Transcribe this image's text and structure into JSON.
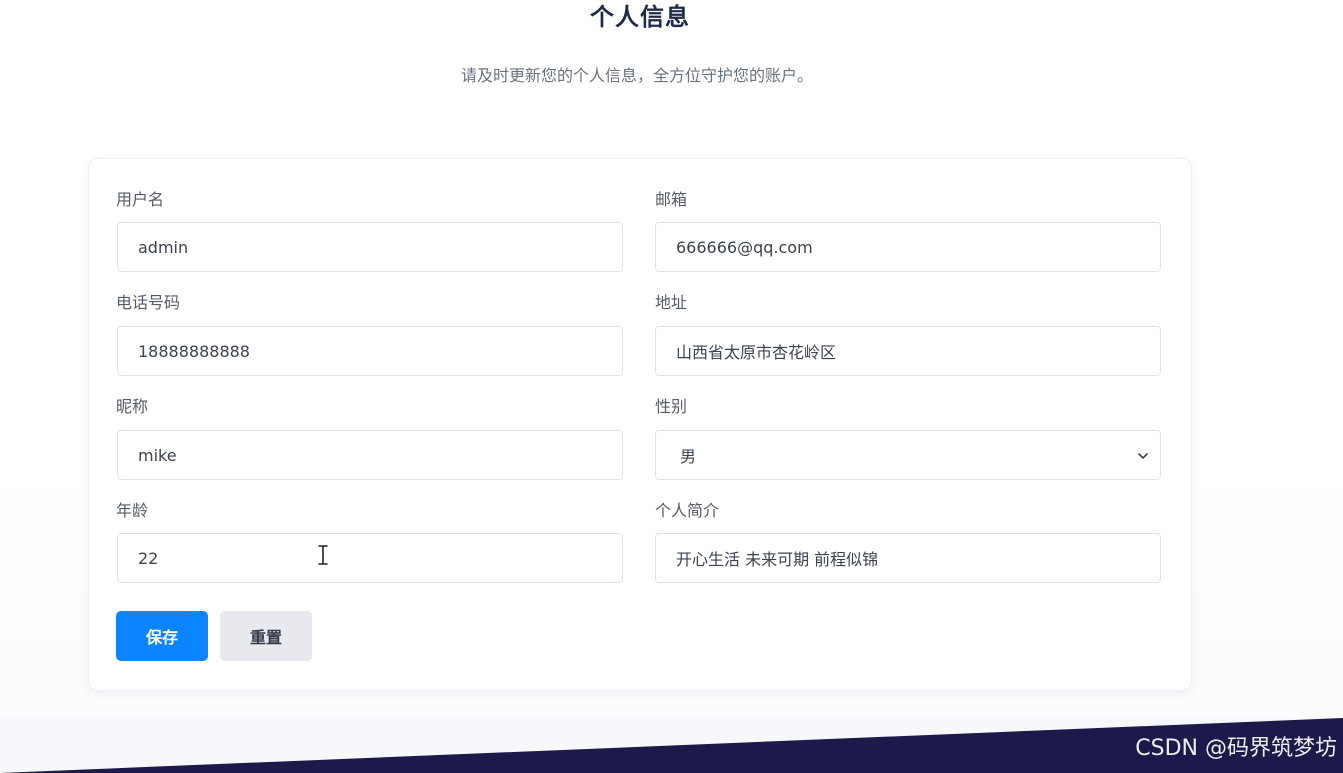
{
  "header": {
    "title": "个人信息",
    "subtitle": "请及时更新您的个人信息，全方位守护您的账户。"
  },
  "form": {
    "username": {
      "label": "用户名",
      "value": "admin"
    },
    "email": {
      "label": "邮箱",
      "value": "666666@qq.com"
    },
    "phone": {
      "label": "电话号码",
      "value": "18888888888"
    },
    "address": {
      "label": "地址",
      "value": "山西省太原市杏花岭区"
    },
    "nickname": {
      "label": "昵称",
      "value": "mike"
    },
    "gender": {
      "label": "性别",
      "value": "男"
    },
    "age": {
      "label": "年龄",
      "value": "22"
    },
    "bio": {
      "label": "个人简介",
      "value": "开心生活 未来可期 前程似锦"
    }
  },
  "actions": {
    "save_label": "保存",
    "reset_label": "重置"
  },
  "watermark": "CSDN @码界筑梦坊",
  "colors": {
    "primary": "#0d84ff",
    "title": "#1e2a4a",
    "footer": "#1b1a4a",
    "reset_bg": "#e8e9ee"
  },
  "icons": {
    "gender_select": "chevron-down-icon",
    "mouse_cursor": "text-cursor-icon"
  }
}
